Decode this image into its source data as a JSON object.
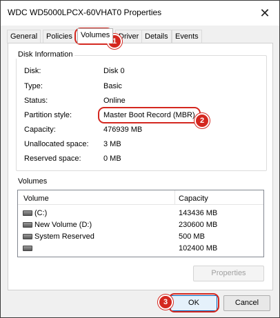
{
  "window": {
    "title": "WDC WD5000LPCX-60VHAT0 Properties",
    "close_glyph": "✕"
  },
  "tabs": [
    {
      "label": "General"
    },
    {
      "label": "Policies"
    },
    {
      "label": "Volumes"
    },
    {
      "label": "Driver"
    },
    {
      "label": "Details"
    },
    {
      "label": "Events"
    }
  ],
  "active_tab": "Volumes",
  "disk_info": {
    "title": "Disk Information",
    "fields": [
      {
        "label": "Disk:",
        "value": "Disk 0"
      },
      {
        "label": "Type:",
        "value": "Basic"
      },
      {
        "label": "Status:",
        "value": "Online"
      },
      {
        "label": "Partition style:",
        "value": "Master Boot Record (MBR)"
      },
      {
        "label": "Capacity:",
        "value": "476939 MB"
      },
      {
        "label": "Unallocated space:",
        "value": "3 MB"
      },
      {
        "label": "Reserved space:",
        "value": "0 MB"
      }
    ]
  },
  "volumes": {
    "title": "Volumes",
    "columns": [
      "Volume",
      "Capacity"
    ],
    "rows": [
      {
        "name": "(C:)",
        "capacity": "143436 MB",
        "icon": "disk-icon"
      },
      {
        "name": "New Volume (D:)",
        "capacity": "230600 MB",
        "icon": "disk-icon"
      },
      {
        "name": "System Reserved",
        "capacity": "500 MB",
        "icon": "disk-icon"
      },
      {
        "name": "",
        "capacity": "102400 MB",
        "icon": "disk-icon"
      }
    ]
  },
  "buttons": {
    "properties": "Properties",
    "ok": "OK",
    "cancel": "Cancel"
  },
  "annotations": {
    "color": "#d4271f",
    "steps": [
      "1",
      "2",
      "3"
    ]
  }
}
